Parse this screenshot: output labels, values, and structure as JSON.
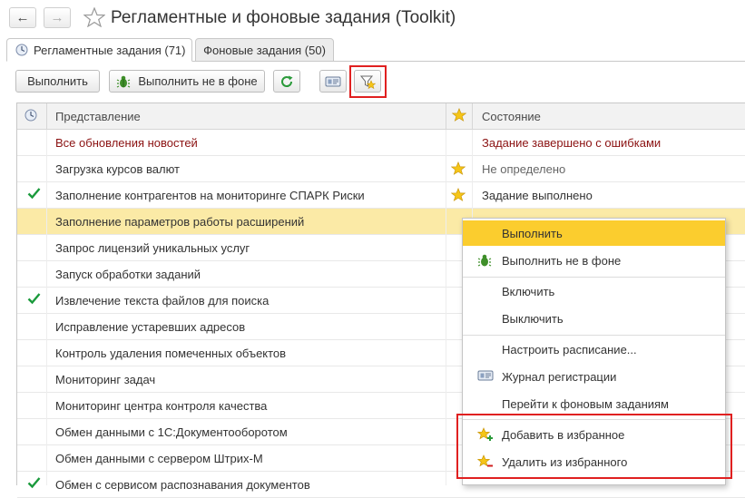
{
  "window": {
    "title": "Регламентные и фоновые задания (Toolkit)",
    "back_arrow": "←",
    "forward_arrow": "→"
  },
  "tabs": [
    {
      "label": "Регламентные задания (71)",
      "active": true
    },
    {
      "label": "Фоновые задания (50)",
      "active": false
    }
  ],
  "toolbar": {
    "run_label": "Выполнить",
    "run_not_background_label": "Выполнить не в фоне"
  },
  "table": {
    "columns": {
      "presentation": "Представление",
      "state": "Состояние"
    },
    "rows": [
      {
        "name": "Все обновления новостей",
        "state": "Задание завершено с ошибками",
        "check": false,
        "favorite": false,
        "status": "error"
      },
      {
        "name": "Загрузка курсов валют",
        "state": "Не определено",
        "check": false,
        "favorite": true,
        "status": "undefined"
      },
      {
        "name": "Заполнение контрагентов на мониторинге СПАРК Риски",
        "state": "Задание выполнено",
        "check": true,
        "favorite": true,
        "status": "done"
      },
      {
        "name": "Заполнение параметров работы расширений",
        "state": "",
        "check": false,
        "favorite": false,
        "status": "selected"
      },
      {
        "name": "Запрос лицензий уникальных услуг",
        "state": "",
        "check": false,
        "favorite": false
      },
      {
        "name": "Запуск обработки заданий",
        "state": "",
        "check": false,
        "favorite": false
      },
      {
        "name": "Извлечение текста файлов для поиска",
        "state": "",
        "check": true,
        "favorite": false
      },
      {
        "name": "Исправление устаревших адресов",
        "state": "",
        "check": false,
        "favorite": false
      },
      {
        "name": "Контроль удаления помеченных объектов",
        "state": "",
        "check": false,
        "favorite": false
      },
      {
        "name": "Мониторинг задач",
        "state": "",
        "check": false,
        "favorite": false
      },
      {
        "name": "Мониторинг центра контроля качества",
        "state": "",
        "check": false,
        "favorite": false
      },
      {
        "name": "Обмен данными с 1С:Документооборотом",
        "state": "",
        "check": false,
        "favorite": false
      },
      {
        "name": "Обмен данными с сервером Штрих-М",
        "state": "",
        "check": false,
        "favorite": false
      },
      {
        "name": "Обмен с сервисом распознавания документов",
        "state": "",
        "check": true,
        "favorite": false
      }
    ]
  },
  "context_menu": {
    "items": [
      {
        "label": "Выполнить",
        "icon": "none",
        "active": true
      },
      {
        "label": "Выполнить не в фоне",
        "icon": "bug-icon"
      },
      {
        "label": "Включить",
        "icon": "none"
      },
      {
        "label": "Выключить",
        "icon": "none"
      },
      {
        "label": "Настроить расписание...",
        "icon": "none"
      },
      {
        "label": "Журнал регистрации",
        "icon": "event-log-icon"
      },
      {
        "label": "Перейти к фоновым заданиям",
        "icon": "none"
      },
      {
        "label": "Добавить в избранное",
        "icon": "star-add-icon"
      },
      {
        "label": "Удалить из избранного",
        "icon": "star-remove-icon"
      }
    ]
  },
  "colors": {
    "highlight_red": "#e02020",
    "selected_row": "#fbeaa6",
    "menu_active": "#fbcd2e",
    "error_text": "#8b1212",
    "check_green": "#1a9a3c",
    "star_yellow": "#f5c518"
  }
}
